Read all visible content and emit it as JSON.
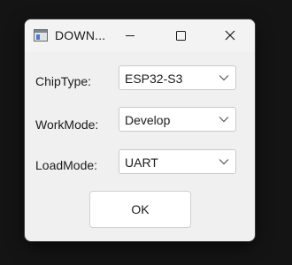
{
  "window": {
    "title": "DOWN...",
    "controls": [
      "minimize-icon",
      "maximize-icon",
      "close-icon"
    ]
  },
  "form": {
    "chip_type": {
      "label": "ChipType:",
      "value": "ESP32-S3"
    },
    "work_mode": {
      "label": "WorkMode:",
      "value": "Develop"
    },
    "load_mode": {
      "label": "LoadMode:",
      "value": "UART"
    }
  },
  "ok_label": "OK",
  "colors": {
    "desktop": "#141414",
    "window_bg": "#f0f0f0",
    "field_bg": "#ffffff",
    "text": "#1b1b1b"
  }
}
